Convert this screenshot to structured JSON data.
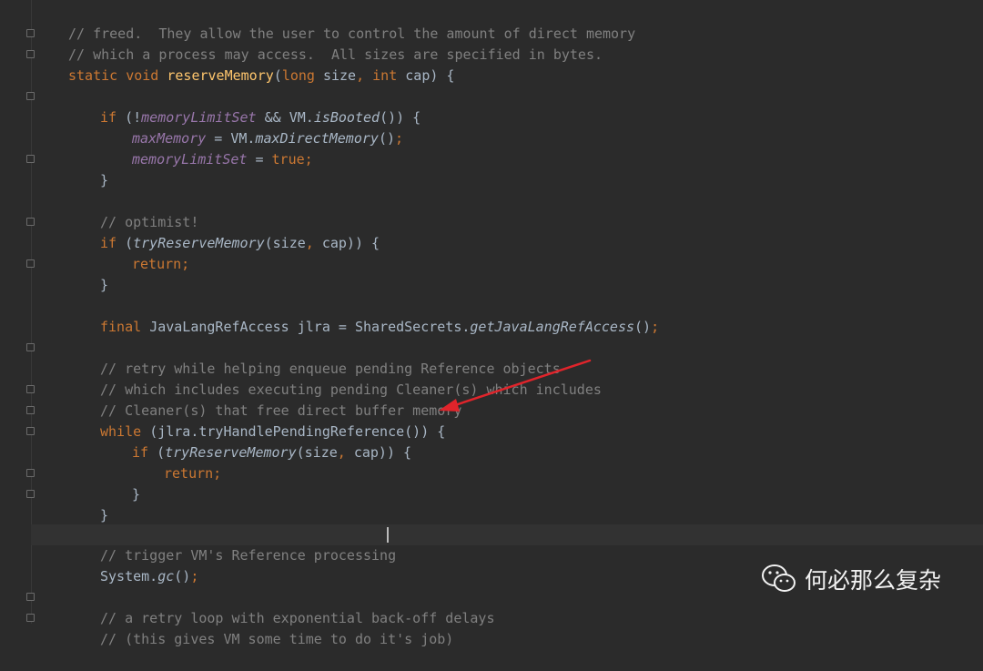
{
  "code_lines": [
    "// freed.  They allow the user to control the amount of direct memory",
    "// which a process may access.  All sizes are specified in bytes.",
    "static void reserveMemory(long size, int cap) {",
    "",
    "if (!memoryLimitSet && VM.isBooted()) {",
    "maxMemory = VM.maxDirectMemory();",
    "memoryLimitSet = true;",
    "}",
    "",
    "// optimist!",
    "if (tryReserveMemory(size, cap)) {",
    "return;",
    "}",
    "",
    "final JavaLangRefAccess jlra = SharedSecrets.getJavaLangRefAccess();",
    "",
    "// retry while helping enqueue pending Reference objects",
    "// which includes executing pending Cleaner(s) which includes",
    "// Cleaner(s) that free direct buffer memory",
    "while (jlra.tryHandlePendingReference()) {",
    "if (tryReserveMemory(size, cap)) {",
    "return;",
    "}",
    "}",
    "",
    "// trigger VM's Reference processing",
    "System.gc();",
    "",
    "// a retry loop with exponential back-off delays",
    "// (this gives VM some time to do it's job)"
  ],
  "watermark": {
    "text": "何必那么复杂",
    "icon": "wechat-icon"
  },
  "colors": {
    "background": "#2b2b2b",
    "keyword": "#cc7832",
    "comment": "#808080",
    "field": "#9876aa",
    "method": "#ffc66d",
    "text": "#a9b7c6",
    "arrow": "#e0242b"
  },
  "highlighted_line": "while (jlra.tryHandlePendingReference()) {"
}
